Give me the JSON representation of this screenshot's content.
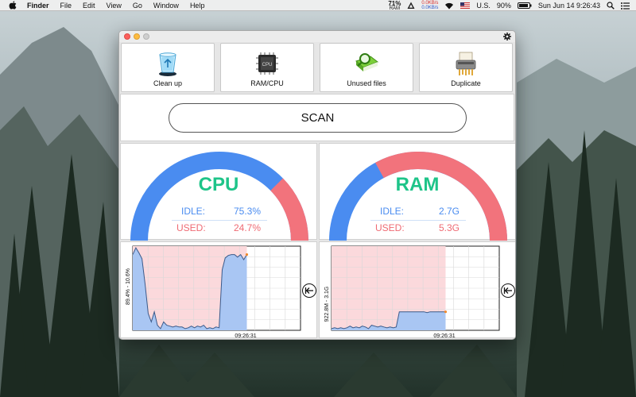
{
  "menubar": {
    "app_name": "Finder",
    "menus": [
      "File",
      "Edit",
      "View",
      "Go",
      "Window",
      "Help"
    ],
    "ram_percent": "71%",
    "ram_label": "RAM",
    "net_up": "0.0KB/s",
    "net_down": "0.0KB/s",
    "input_source": "U.S.",
    "battery": "90%",
    "datetime": "Sun Jun 14  9:26:43"
  },
  "toolbar": {
    "cleanup_label": "Clean up",
    "ramcpu_label": "RAM/CPU",
    "unused_label": "Unused files",
    "duplicate_label": "Duplicate",
    "chip_text": "CPU"
  },
  "scan": {
    "label": "SCAN"
  },
  "cpu": {
    "title": "CPU",
    "idle_label": "IDLE:",
    "idle_value": "75.3%",
    "used_label": "USED:",
    "used_value": "24.7%",
    "used_fraction": 0.247
  },
  "ram": {
    "title": "RAM",
    "idle_label": "IDLE:",
    "idle_value": "2.7G",
    "used_label": "USED:",
    "used_value": "5.3G",
    "used_fraction": 0.66
  },
  "cpu_chart": {
    "ylabel": "89.4% - 10.6%",
    "time_label": "09:26:31",
    "series": [
      0.9,
      0.98,
      0.92,
      0.85,
      0.55,
      0.2,
      0.1,
      0.22,
      0.06,
      0.02,
      0.1,
      0.06,
      0.05,
      0.04,
      0.05,
      0.04,
      0.04,
      0.02,
      0.03,
      0.05,
      0.03,
      0.05,
      0.04,
      0.06,
      0.02,
      0.03,
      0.02,
      0.04,
      0.03,
      0.72,
      0.86,
      0.89,
      0.9,
      0.9,
      0.87,
      0.9,
      0.84,
      0.9
    ]
  },
  "ram_chart": {
    "ylabel": "922.8M - 3.1G",
    "time_label": "09:26:31",
    "series": [
      0.02,
      0.03,
      0.02,
      0.03,
      0.02,
      0.03,
      0.05,
      0.03,
      0.04,
      0.03,
      0.05,
      0.04,
      0.02,
      0.06,
      0.05,
      0.04,
      0.05,
      0.04,
      0.03,
      0.04,
      0.03,
      0.04,
      0.22,
      0.22,
      0.22,
      0.22,
      0.22,
      0.22,
      0.22,
      0.22,
      0.22,
      0.21,
      0.22,
      0.22,
      0.22,
      0.22,
      0.22,
      0.22
    ]
  },
  "colors": {
    "blue": "#4a8cf0",
    "red": "#f2737c",
    "green": "#1ec489",
    "area_fill": "#a9c6f3",
    "area_bg": "#fbd9dc"
  }
}
